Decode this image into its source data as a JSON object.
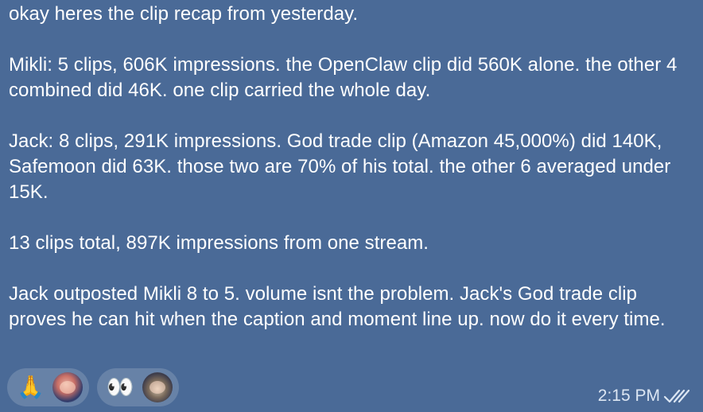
{
  "message": {
    "paragraphs": [
      "okay heres the clip recap from yesterday.",
      "Mikli: 5 clips, 606K impressions. the OpenClaw clip did 560K alone. the other 4 combined did 46K. one clip carried the whole day.",
      "Jack: 8 clips, 291K impressions. God trade clip (Amazon 45,000%) did 140K, Safemoon did 63K. those two are 70% of his total. the other 6 averaged under 15K.",
      "13 clips total, 897K impressions from one stream.",
      "Jack outposted Mikli 8 to 5. volume isnt the problem. Jack's God trade clip proves he can hit when the caption and moment line up. now do it every time."
    ],
    "time": "2:15 PM"
  },
  "reactions": [
    {
      "emoji": "🙏",
      "icon": "folded-hands-emoji",
      "reactor": "avatar"
    },
    {
      "emoji": "👀",
      "icon": "eyes-emoji",
      "reactor": "avatar"
    }
  ],
  "colors": {
    "bubble": "#4a6a97",
    "text": "#ffffff",
    "meta": "#dce6f3"
  }
}
